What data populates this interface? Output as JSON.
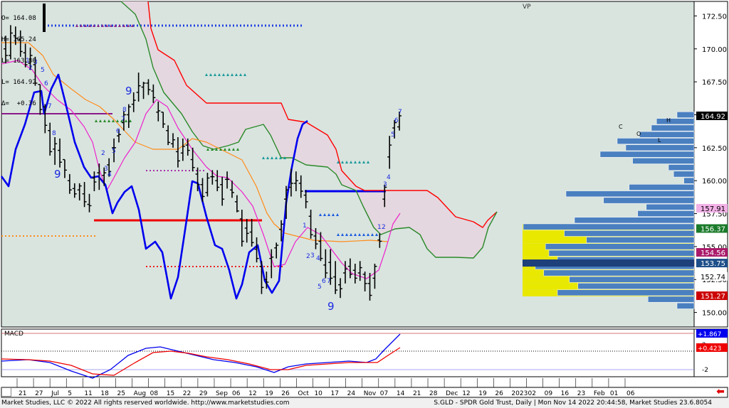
{
  "ohlc_box": {
    "open_label": "O= 164.08",
    "high_label": "H= 165.24",
    "low_label": "L= 163.80",
    "last_label": "L= 164.92",
    "delta_label": "Δ=  +0.36"
  },
  "vp_label": "VP",
  "macd_label": "MACD",
  "footer": {
    "left": "Market Studies, LLC © 2022 All rights reserved worldwide. http://www.marketstudies.com",
    "right": "S.GLD - SPDR Gold Trust, Daily | Mon Nov 14 2022 20:44:58, Market Studies 23.6.8054"
  },
  "colors": {
    "background": "#d9e4df",
    "cloud": "#e6d5df",
    "price_bars": "#000000",
    "blue_line": "#0000ee",
    "orange_line": "#ff8c1a",
    "magenta_line": "#ee22cc",
    "red_line": "#ff0000",
    "green_line": "#2a8a2a",
    "macd_line": "#0000ee",
    "signal_line": "#ee0000",
    "vp_bar": "#4a7fc0",
    "vp_highlight": "#e8e800"
  },
  "chart_data": {
    "type": "candlestick-ohlc-bars",
    "symbol": "S.GLD",
    "title": "SPDR Gold Trust, Daily",
    "y_axis": {
      "ticks": [
        150.0,
        152.5,
        155.0,
        157.5,
        160.0,
        162.5,
        165.0,
        167.5,
        170.0,
        172.5
      ],
      "tick_labels": [
        "150.00",
        "152.50",
        "155.00",
        "157.50",
        "160.00",
        "162.50",
        "165.00",
        "167.50",
        "170.00",
        "172.50"
      ],
      "range": [
        148.9,
        173.6
      ]
    },
    "x_axis": {
      "day_labels": [
        "21",
        "27",
        "Jul",
        "5",
        "11",
        "18",
        "25",
        "Aug",
        "08",
        "15",
        "22",
        "29",
        "Sep",
        "06",
        "12",
        "19",
        "26",
        "Oct",
        "10",
        "17",
        "24",
        "Nov",
        "07",
        "14",
        "21",
        "28",
        "Dec",
        "12",
        "19",
        "26",
        "2023",
        "02",
        "09",
        "16",
        "23",
        "Feb",
        "01",
        "06"
      ]
    },
    "price_labels": [
      {
        "value": 164.92,
        "text": "164.92",
        "bg": "#000000",
        "fg": "#ffffff"
      },
      {
        "value": 157.91,
        "text": "157.91",
        "bg": "#f2b0e6",
        "fg": "#000000"
      },
      {
        "value": 156.37,
        "text": "156.37",
        "bg": "#1a7a2a",
        "fg": "#ffffff"
      },
      {
        "value": 154.56,
        "text": "154.56",
        "bg": "#aa1a6a",
        "fg": "#ffffff"
      },
      {
        "value": 153.75,
        "text": "153.75",
        "bg": "#1d4f8a",
        "fg": "#ffffff"
      },
      {
        "value": 152.74,
        "text": "152.74",
        "bg": "#ffffff",
        "fg": "#000000"
      },
      {
        "value": 151.27,
        "text": "151.27",
        "bg": "#cc0000",
        "fg": "#ffffff"
      }
    ],
    "price_bars": [
      [
        171.0,
        170.0,
        168.9,
        169.5
      ],
      [
        171.8,
        169.5,
        169.2,
        171.2
      ],
      [
        171.7,
        171.0,
        170.3,
        170.8
      ],
      [
        171.4,
        170.7,
        169.4,
        169.8
      ],
      [
        170.4,
        169.7,
        168.6,
        168.8
      ],
      [
        170.1,
        168.9,
        168.4,
        169.5
      ],
      [
        169.4,
        168.8,
        167.2,
        167.4
      ],
      [
        167.3,
        167.3,
        165.0,
        165.4
      ],
      [
        165.8,
        165.6,
        163.6,
        164.2
      ],
      [
        164.4,
        163.8,
        161.9,
        162.2
      ],
      [
        163.3,
        162.4,
        161.2,
        162.8
      ],
      [
        163.2,
        162.3,
        161.0,
        161.4
      ],
      [
        161.6,
        161.6,
        160.2,
        160.8
      ],
      [
        160.5,
        160.0,
        159.0,
        159.3
      ],
      [
        159.8,
        159.4,
        158.7,
        159.0
      ],
      [
        159.8,
        159.3,
        158.5,
        159.6
      ],
      [
        159.9,
        159.0,
        158.0,
        158.4
      ],
      [
        159.0,
        158.2,
        157.6,
        158.1
      ],
      [
        160.7,
        160.2,
        159.2,
        159.9
      ],
      [
        161.3,
        160.6,
        159.3,
        160.1
      ],
      [
        161.0,
        160.4,
        159.6,
        160.6
      ],
      [
        161.7,
        161.2,
        160.3,
        160.7
      ],
      [
        163.2,
        162.5,
        161.4,
        162.5
      ],
      [
        163.9,
        163.4,
        162.9,
        163.5
      ],
      [
        165.3,
        164.4,
        163.8,
        165.0
      ],
      [
        165.8,
        165.0,
        164.0,
        165.6
      ],
      [
        166.7,
        165.8,
        165.2,
        166.1
      ],
      [
        168.2,
        166.7,
        166.0,
        167.2
      ],
      [
        167.5,
        167.1,
        166.2,
        167.4
      ],
      [
        167.7,
        167.4,
        166.5,
        166.9
      ],
      [
        167.3,
        166.8,
        165.9,
        166.3
      ],
      [
        166.0,
        165.2,
        164.5,
        165.3
      ],
      [
        165.2,
        165.2,
        164.0,
        164.3
      ],
      [
        164.2,
        163.8,
        162.7,
        162.9
      ],
      [
        163.6,
        162.8,
        162.5,
        163.1
      ],
      [
        163.3,
        162.2,
        161.0,
        161.5
      ],
      [
        163.2,
        162.1,
        161.5,
        162.6
      ],
      [
        163.2,
        162.7,
        161.9,
        162.3
      ],
      [
        162.5,
        161.6,
        160.7,
        161.0
      ],
      [
        161.0,
        160.5,
        159.2,
        159.7
      ],
      [
        160.2,
        159.7,
        158.4,
        158.8
      ],
      [
        160.6,
        159.1,
        158.8,
        160.2
      ],
      [
        160.8,
        160.3,
        159.7,
        160.3
      ],
      [
        160.8,
        160.0,
        159.2,
        159.5
      ],
      [
        160.3,
        159.7,
        158.1,
        158.6
      ],
      [
        160.7,
        160.1,
        159.4,
        160.1
      ],
      [
        160.0,
        159.3,
        158.7,
        159.1
      ],
      [
        158.9,
        158.4,
        157.6,
        157.7
      ],
      [
        157.8,
        157.1,
        155.0,
        155.4
      ],
      [
        157.1,
        156.4,
        155.3,
        156.0
      ],
      [
        157.1,
        156.1,
        155.0,
        155.3
      ],
      [
        155.7,
        154.8,
        153.8,
        154.1
      ],
      [
        153.9,
        153.5,
        151.4,
        151.9
      ],
      [
        153.1,
        152.5,
        151.8,
        152.3
      ],
      [
        154.8,
        154.1,
        152.6,
        154.2
      ],
      [
        155.3,
        154.9,
        154.1,
        155.1
      ],
      [
        157.0,
        156.3,
        155.4,
        156.7
      ],
      [
        159.6,
        158.6,
        157.1,
        159.3
      ],
      [
        160.9,
        159.5,
        158.8,
        159.8
      ],
      [
        160.7,
        159.8,
        159.2,
        160.0
      ],
      [
        160.4,
        159.8,
        158.7,
        159.2
      ],
      [
        159.3,
        158.9,
        157.9,
        158.4
      ],
      [
        157.8,
        157.3,
        155.6,
        155.9
      ],
      [
        156.4,
        155.8,
        154.8,
        155.2
      ],
      [
        156.1,
        155.4,
        153.9,
        154.1
      ],
      [
        154.8,
        153.6,
        152.6,
        153.0
      ],
      [
        154.8,
        153.8,
        152.1,
        152.6
      ],
      [
        153.9,
        152.7,
        151.4,
        151.7
      ],
      [
        152.6,
        152.1,
        151.1,
        151.8
      ],
      [
        153.9,
        153.0,
        152.2,
        153.3
      ],
      [
        154.1,
        153.5,
        152.6,
        152.9
      ],
      [
        153.7,
        153.2,
        152.2,
        152.6
      ],
      [
        153.9,
        153.0,
        152.4,
        153.4
      ],
      [
        153.1,
        152.9,
        151.6,
        152.2
      ],
      [
        153.0,
        152.2,
        150.9,
        151.3
      ],
      [
        153.7,
        152.6,
        151.8,
        153.5
      ],
      [
        156.0,
        155.5,
        154.9,
        155.4
      ],
      [
        159.7,
        158.6,
        158.0,
        159.5
      ],
      [
        163.4,
        161.8,
        160.9,
        162.7
      ],
      [
        164.6,
        164.0,
        163.2,
        164.4
      ],
      [
        165.24,
        164.08,
        163.8,
        164.92
      ]
    ],
    "overlays": [
      "blue oscillator",
      "orange moving average",
      "magenta moving average",
      "red cloud boundary",
      "green cloud boundary",
      "horizontal support/resistance segments"
    ],
    "volume_profile": {
      "rows": [
        {
          "price": 165.0,
          "width": 0.1,
          "highlight": false
        },
        {
          "price": 164.5,
          "width": 0.22,
          "highlight": false
        },
        {
          "price": 164.0,
          "width": 0.25,
          "highlight": false
        },
        {
          "price": 163.5,
          "width": 0.32,
          "highlight": false
        },
        {
          "price": 163.0,
          "width": 0.45,
          "highlight": false
        },
        {
          "price": 162.5,
          "width": 0.4,
          "highlight": false
        },
        {
          "price": 162.0,
          "width": 0.55,
          "highlight": false
        },
        {
          "price": 161.5,
          "width": 0.36,
          "highlight": false
        },
        {
          "price": 161.0,
          "width": 0.15,
          "highlight": false
        },
        {
          "price": 160.5,
          "width": 0.12,
          "highlight": false
        },
        {
          "price": 160.0,
          "width": 0.06,
          "highlight": false
        },
        {
          "price": 159.5,
          "width": 0.38,
          "highlight": false
        },
        {
          "price": 159.0,
          "width": 0.75,
          "highlight": false
        },
        {
          "price": 158.5,
          "width": 0.53,
          "highlight": false
        },
        {
          "price": 158.0,
          "width": 0.28,
          "highlight": false
        },
        {
          "price": 157.5,
          "width": 0.33,
          "highlight": false
        },
        {
          "price": 157.0,
          "width": 0.7,
          "highlight": false
        },
        {
          "price": 156.5,
          "width": 1.0,
          "highlight": true
        },
        {
          "price": 156.0,
          "width": 0.76,
          "highlight": true
        },
        {
          "price": 155.5,
          "width": 0.63,
          "highlight": true
        },
        {
          "price": 155.0,
          "width": 0.87,
          "highlight": true
        },
        {
          "price": 154.5,
          "width": 0.85,
          "highlight": true
        },
        {
          "price": 154.0,
          "width": 0.8,
          "highlight": true
        },
        {
          "price": 153.5,
          "width": 0.93,
          "highlight": true
        },
        {
          "price": 153.0,
          "width": 0.88,
          "highlight": true
        },
        {
          "price": 152.5,
          "width": 0.73,
          "highlight": true
        },
        {
          "price": 152.0,
          "width": 0.68,
          "highlight": true
        },
        {
          "price": 151.5,
          "width": 0.8,
          "highlight": true
        },
        {
          "price": 151.0,
          "width": 0.27,
          "highlight": false
        },
        {
          "price": 150.5,
          "width": 0.1,
          "highlight": false
        }
      ]
    },
    "annotations": [
      "1",
      "2",
      "3",
      "4",
      "5",
      "6",
      "7",
      "8",
      "9",
      "9",
      "9",
      "12"
    ],
    "macd_panel": {
      "label": "MACD",
      "tick_labels": [
        "2",
        "-2"
      ],
      "value_labels": [
        {
          "text": "+1.867",
          "bg": "#0000ee",
          "fg": "#ffffff"
        },
        {
          "text": "+0.423",
          "bg": "#ee0000",
          "fg": "#ffffff"
        }
      ]
    }
  }
}
